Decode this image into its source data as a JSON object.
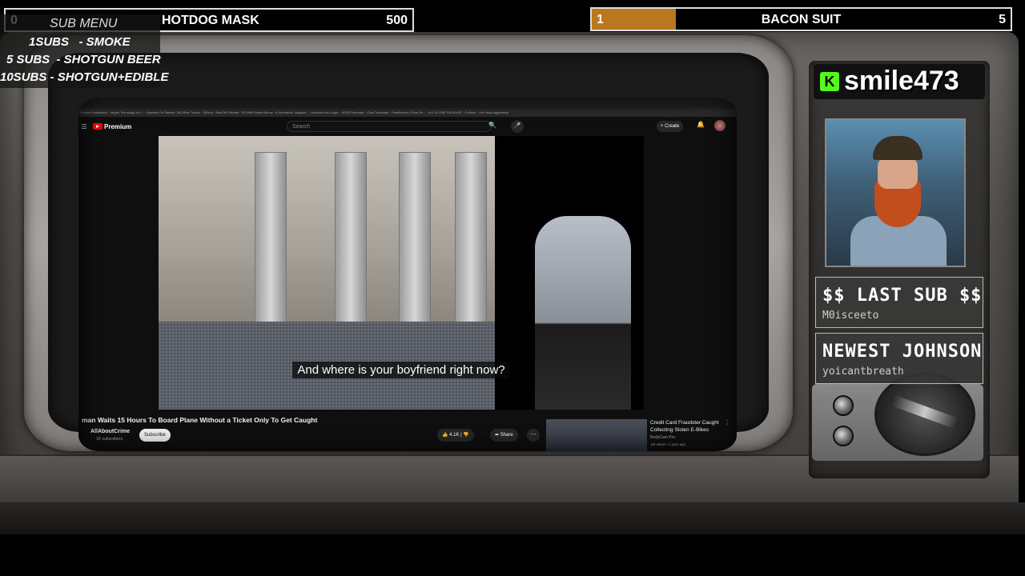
{
  "goal_bars": {
    "left": {
      "count": "0",
      "label": "HOTDOG MASK",
      "goal": "500",
      "progress": 0
    },
    "right": {
      "count": "1",
      "label": "BACON SUIT",
      "goal": "5",
      "progress": 0.2
    }
  },
  "sub_menu": {
    "title": "SUB MENU",
    "items": [
      "1SUBS   - SMOKE",
      "5 SUBS  - SHOTGUN BEER",
      "10SUBS - SHOTGUN+EDIBLE"
    ]
  },
  "channel": {
    "icon": "kick-logo-icon",
    "icon_letter": "K",
    "name": "smile473"
  },
  "last_sub": {
    "title": "$$ LAST SUB $$",
    "value": "M0isceeto"
  },
  "newest": {
    "title": "NEWEST JOHNSON",
    "value": "yoicantbreath"
  },
  "browser": {
    "bookmarks": "Creator Dashboard · Vegan The magic of b... · Marbles On Stream · All Other Tracks · GitHub · AlexC99 Stream · EC09W Easter Bunny · A Wonderful, Magical... · Amazon.com Login · VEXR Repeater · Chat Translator · FreshKoven | Rust Se... · ALL IN ONE PACKAGE · Outlook · The Vault Aggressive"
  },
  "youtube": {
    "logo": "Premium",
    "search_placeholder": "Search",
    "create_label": "Create",
    "subtitle": "And where is your boyfriend right now?",
    "video_title": "man Waits 15 Hours To Board Plane Without a Ticket Only To Get Caught",
    "channel_name": "AllAboutCrime",
    "channel_subs": "1K subscribers",
    "subscribe_label": "Subscribe",
    "likes": "4.1K",
    "share_label": "Share",
    "recommended": {
      "title": "Credit Card Fraudster Caught Collecting Stolen E-Bikes",
      "channel": "BodyCam Pro",
      "meta": "1M views • 1 year ago"
    }
  }
}
